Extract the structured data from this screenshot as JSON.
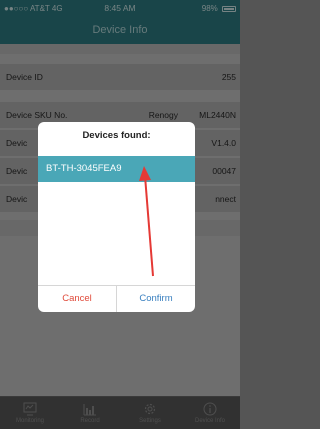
{
  "status": {
    "carrier": "●●○○○ AT&T  4G",
    "time": "8:45 AM",
    "battery": "98%"
  },
  "nav": {
    "title": "Device Info"
  },
  "rows": [
    {
      "label": "Device ID",
      "value": "255",
      "mid": ""
    },
    {
      "label": "Device SKU No.",
      "value": "ML2440N",
      "mid": "Renogy"
    },
    {
      "label": "Devic",
      "value": "V1.4.0",
      "mid": ""
    },
    {
      "label": "Devic",
      "value": "00047",
      "mid": ""
    },
    {
      "label": "Devic",
      "value": "nnect",
      "mid": ""
    }
  ],
  "dialog": {
    "title": "Devices found:",
    "device": "BT-TH-3045FEA9",
    "cancel": "Cancel",
    "confirm": "Confirm"
  },
  "tabs": [
    {
      "label": "Monitoring",
      "icon": "monitoring-icon"
    },
    {
      "label": "Record",
      "icon": "record-icon"
    },
    {
      "label": "Settings",
      "icon": "gear-icon"
    },
    {
      "label": "Device Info",
      "icon": "info-icon"
    }
  ],
  "colors": {
    "accent": "#2f7f85",
    "highlight": "#4aa7b7",
    "arrow": "#e53935"
  }
}
